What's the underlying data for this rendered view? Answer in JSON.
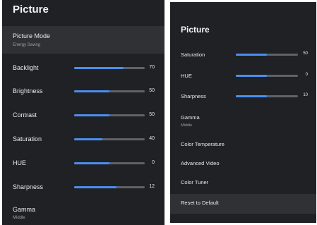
{
  "left": {
    "title": "Picture",
    "picture_mode": {
      "label": "Picture Mode",
      "value": "Energy Saving"
    },
    "sliders": [
      {
        "label": "Backlight",
        "value": "70",
        "level": 0.7
      },
      {
        "label": "Brightness",
        "value": "50",
        "level": 0.5
      },
      {
        "label": "Contrast",
        "value": "50",
        "level": 0.5
      },
      {
        "label": "Saturation",
        "value": "40",
        "level": 0.4
      },
      {
        "label": "HUE",
        "value": "0",
        "level": 0.5
      },
      {
        "label": "Sharpness",
        "value": "12",
        "level": 0.6
      }
    ],
    "gamma": {
      "label": "Gamma",
      "value": "Middle"
    }
  },
  "right": {
    "title": "Picture",
    "sliders": [
      {
        "label": "Saturation",
        "value": "50",
        "level": 0.5
      },
      {
        "label": "HUE",
        "value": "0",
        "level": 0.5
      },
      {
        "label": "Sharpness",
        "value": "10",
        "level": 0.5
      }
    ],
    "gamma": {
      "label": "Gamma",
      "value": "Middle"
    },
    "items": [
      {
        "label": "Color Temperature"
      },
      {
        "label": "Advanced Video"
      },
      {
        "label": "Color Tuner"
      },
      {
        "label": "Reset to Default"
      }
    ]
  },
  "colors": {
    "panel": "#202124",
    "accent": "#4a8ff0",
    "track": "#5f6368",
    "highlight": "#2f3134"
  }
}
